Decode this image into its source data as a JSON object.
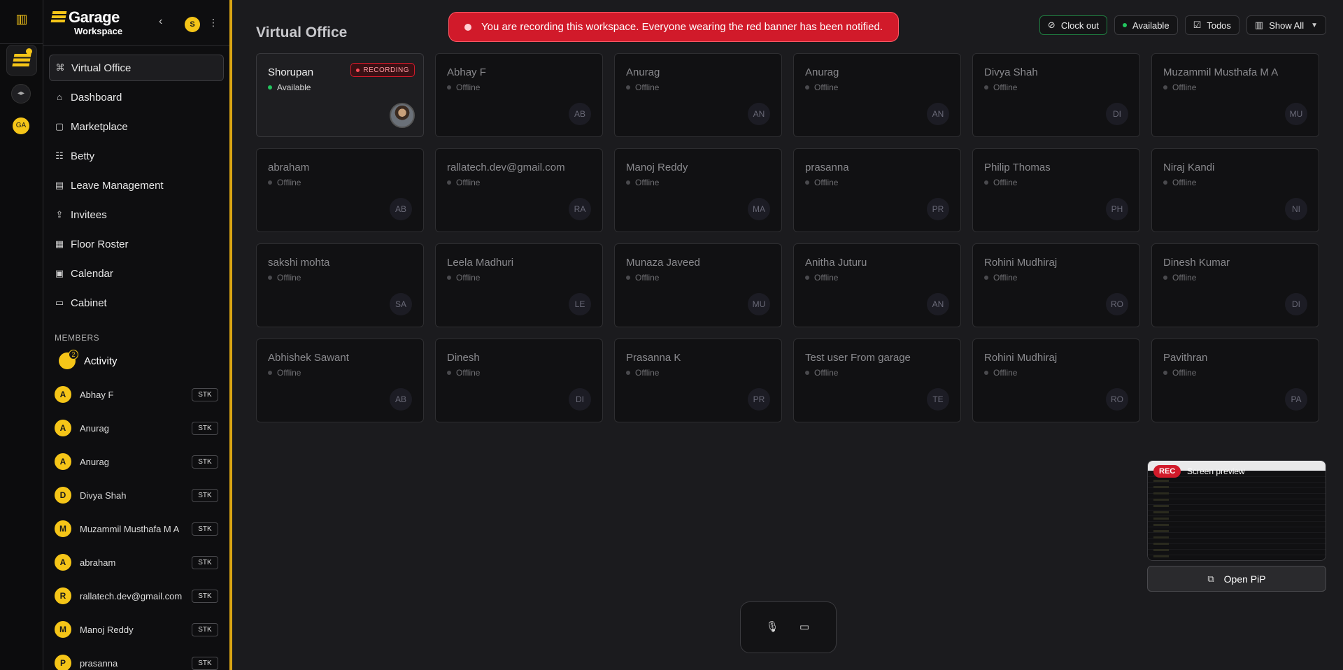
{
  "rail": {
    "ws_badge": "GA"
  },
  "brand": {
    "name": "Garage",
    "subtitle": "Workspace",
    "user_initial": "S"
  },
  "nav": [
    {
      "label": "Virtual Office",
      "icon": "people-network-icon",
      "glyph": "⌘",
      "active": true
    },
    {
      "label": "Dashboard",
      "icon": "home-icon",
      "glyph": "⌂",
      "active": false
    },
    {
      "label": "Marketplace",
      "icon": "bag-icon",
      "glyph": "▢",
      "active": false
    },
    {
      "label": "Betty",
      "icon": "bot-icon",
      "glyph": "☷",
      "active": false
    },
    {
      "label": "Leave Management",
      "icon": "document-icon",
      "glyph": "▤",
      "active": false
    },
    {
      "label": "Invitees",
      "icon": "upload-icon",
      "glyph": "⇪",
      "active": false
    },
    {
      "label": "Floor Roster",
      "icon": "building-icon",
      "glyph": "▦",
      "active": false
    },
    {
      "label": "Calendar",
      "icon": "calendar-icon",
      "glyph": "▣",
      "active": false
    },
    {
      "label": "Cabinet",
      "icon": "folder-icon",
      "glyph": "▭",
      "active": false
    }
  ],
  "members_heading": "MEMBERS",
  "activity": {
    "label": "Activity",
    "count": "2"
  },
  "members": [
    {
      "initial": "A",
      "name": "Abhay F",
      "tag": "STK"
    },
    {
      "initial": "A",
      "name": "Anurag",
      "tag": "STK"
    },
    {
      "initial": "A",
      "name": "Anurag",
      "tag": "STK"
    },
    {
      "initial": "D",
      "name": "Divya Shah",
      "tag": "STK"
    },
    {
      "initial": "M",
      "name": "Muzammil Musthafa M A",
      "tag": "STK"
    },
    {
      "initial": "A",
      "name": "abraham",
      "tag": "STK"
    },
    {
      "initial": "R",
      "name": "rallatech.dev@gmail.com",
      "tag": "STK"
    },
    {
      "initial": "M",
      "name": "Manoj Reddy",
      "tag": "STK"
    },
    {
      "initial": "P",
      "name": "prasanna",
      "tag": "STK"
    }
  ],
  "page_title": "Virtual Office",
  "banner": "You are recording this workspace. Everyone wearing the red banner has been notified.",
  "toolbar": {
    "clock_out": "Clock out",
    "available": "Available",
    "todos": "Todos",
    "show_all": "Show All"
  },
  "cards": [
    {
      "name": "Shorupan",
      "status": "Available",
      "online": true,
      "badge": "RECORDING"
    },
    {
      "name": "Abhay F",
      "status": "Offline",
      "initials": "AB"
    },
    {
      "name": "Anurag",
      "status": "Offline",
      "initials": "AN"
    },
    {
      "name": "Anurag",
      "status": "Offline",
      "initials": "AN"
    },
    {
      "name": "Divya Shah",
      "status": "Offline",
      "initials": "DI"
    },
    {
      "name": "Muzammil Musthafa M A",
      "status": "Offline",
      "initials": "MU"
    },
    {
      "name": "abraham",
      "status": "Offline",
      "initials": "AB"
    },
    {
      "name": "rallatech.dev@gmail.com",
      "status": "Offline",
      "initials": "RA"
    },
    {
      "name": "Manoj Reddy",
      "status": "Offline",
      "initials": "MA"
    },
    {
      "name": "prasanna",
      "status": "Offline",
      "initials": "PR"
    },
    {
      "name": "Philip Thomas",
      "status": "Offline",
      "initials": "PH"
    },
    {
      "name": "Niraj Kandi",
      "status": "Offline",
      "initials": "NI"
    },
    {
      "name": "sakshi mohta",
      "status": "Offline",
      "initials": "SA"
    },
    {
      "name": "Leela Madhuri",
      "status": "Offline",
      "initials": "LE"
    },
    {
      "name": "Munaza Javeed",
      "status": "Offline",
      "initials": "MU"
    },
    {
      "name": "Anitha Juturu",
      "status": "Offline",
      "initials": "AN"
    },
    {
      "name": "Rohini Mudhiraj",
      "status": "Offline",
      "initials": "RO"
    },
    {
      "name": "Dinesh Kumar",
      "status": "Offline",
      "initials": "DI"
    },
    {
      "name": "Abhishek Sawant",
      "status": "Offline",
      "initials": "AB"
    },
    {
      "name": "Dinesh",
      "status": "Offline",
      "initials": "DI"
    },
    {
      "name": "Prasanna K",
      "status": "Offline",
      "initials": "PR"
    },
    {
      "name": "Test user From garage",
      "status": "Offline",
      "initials": "TE"
    },
    {
      "name": "Rohini Mudhiraj",
      "status": "Offline",
      "initials": "RO"
    },
    {
      "name": "Pavithran",
      "status": "Offline",
      "initials": "PA"
    }
  ],
  "pip": {
    "rec": "REC",
    "title": "Screen preview",
    "open_label": "Open PiP"
  },
  "colors": {
    "accent": "#f5c518",
    "recording": "#d11a2a",
    "online": "#22c55e"
  }
}
